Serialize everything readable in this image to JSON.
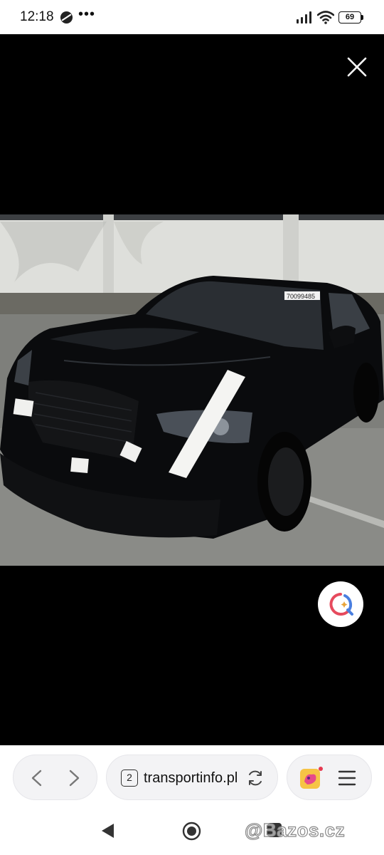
{
  "status_bar": {
    "time": "12:18",
    "notification_dots": "•••",
    "battery_level": "69"
  },
  "viewer": {
    "background": "#000000",
    "photo": {
      "windshield_sticker": "70099485"
    }
  },
  "browser_bar": {
    "tab_count": "2",
    "url": "transportinfo.pl",
    "accent": "#e63950"
  },
  "watermark": "@Bazos.cz",
  "icons": {
    "close": "close-icon",
    "lens": "lens-search-icon",
    "back": "chevron-left-icon",
    "forward": "chevron-right-icon",
    "reload": "reload-icon",
    "extension": "extension-icon",
    "menu": "hamburger-menu-icon",
    "system_back": "triangle-back-icon",
    "system_home": "circle-home-icon",
    "system_recents": "square-recents-icon"
  }
}
